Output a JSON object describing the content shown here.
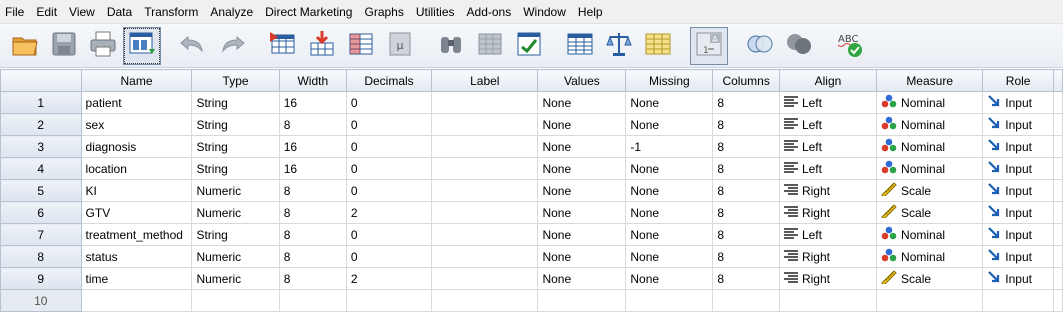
{
  "menu": [
    "File",
    "Edit",
    "View",
    "Data",
    "Transform",
    "Analyze",
    "Direct Marketing",
    "Graphs",
    "Utilities",
    "Add-ons",
    "Window",
    "Help"
  ],
  "toolbar": [
    {
      "name": "open-icon"
    },
    {
      "name": "save-icon"
    },
    {
      "name": "print-icon"
    },
    {
      "name": "dialog-recall-icon"
    },
    {
      "name": "undo-icon"
    },
    {
      "name": "redo-icon"
    },
    {
      "name": "goto-case-icon"
    },
    {
      "name": "goto-variable-icon"
    },
    {
      "name": "variables-icon"
    },
    {
      "name": "run-descriptives-icon"
    },
    {
      "name": "find-icon"
    },
    {
      "name": "insert-cases-icon"
    },
    {
      "name": "insert-variable-icon"
    },
    {
      "name": "split-file-icon"
    },
    {
      "name": "weight-cases-icon"
    },
    {
      "name": "select-cases-icon"
    },
    {
      "name": "value-labels-icon"
    },
    {
      "name": "use-variable-sets-icon"
    },
    {
      "name": "show-all-variables-icon"
    },
    {
      "name": "spell-check-icon"
    }
  ],
  "columns": [
    "Name",
    "Type",
    "Width",
    "Decimals",
    "Label",
    "Values",
    "Missing",
    "Columns",
    "Align",
    "Measure",
    "Role"
  ],
  "rows": [
    {
      "n": "1",
      "name": "patient",
      "type": "String",
      "width": "16",
      "decimals": "0",
      "label": "",
      "values": "None",
      "missing": "None",
      "columns": "8",
      "align": "Left",
      "measure": "Nominal",
      "role": "Input"
    },
    {
      "n": "2",
      "name": "sex",
      "type": "String",
      "width": "8",
      "decimals": "0",
      "label": "",
      "values": "None",
      "missing": "None",
      "columns": "8",
      "align": "Left",
      "measure": "Nominal",
      "role": "Input"
    },
    {
      "n": "3",
      "name": "diagnosis",
      "type": "String",
      "width": "16",
      "decimals": "0",
      "label": "",
      "values": "None",
      "missing": "-1",
      "columns": "8",
      "align": "Left",
      "measure": "Nominal",
      "role": "Input"
    },
    {
      "n": "4",
      "name": "location",
      "type": "String",
      "width": "16",
      "decimals": "0",
      "label": "",
      "values": "None",
      "missing": "None",
      "columns": "8",
      "align": "Left",
      "measure": "Nominal",
      "role": "Input"
    },
    {
      "n": "5",
      "name": "KI",
      "type": "Numeric",
      "width": "8",
      "decimals": "0",
      "label": "",
      "values": "None",
      "missing": "None",
      "columns": "8",
      "align": "Right",
      "measure": "Scale",
      "role": "Input"
    },
    {
      "n": "6",
      "name": "GTV",
      "type": "Numeric",
      "width": "8",
      "decimals": "2",
      "label": "",
      "values": "None",
      "missing": "None",
      "columns": "8",
      "align": "Right",
      "measure": "Scale",
      "role": "Input"
    },
    {
      "n": "7",
      "name": "treatment_method",
      "type": "String",
      "width": "8",
      "decimals": "0",
      "label": "",
      "values": "None",
      "missing": "None",
      "columns": "8",
      "align": "Left",
      "measure": "Nominal",
      "role": "Input"
    },
    {
      "n": "8",
      "name": "status",
      "type": "Numeric",
      "width": "8",
      "decimals": "0",
      "label": "",
      "values": "None",
      "missing": "None",
      "columns": "8",
      "align": "Right",
      "measure": "Nominal",
      "role": "Input"
    },
    {
      "n": "9",
      "name": "time",
      "type": "Numeric",
      "width": "8",
      "decimals": "2",
      "label": "",
      "values": "None",
      "missing": "None",
      "columns": "8",
      "align": "Right",
      "measure": "Scale",
      "role": "Input"
    }
  ],
  "empty_row": "10",
  "colors": {
    "accent": "#1a5fb4",
    "header_bg": "#e3e9f1",
    "grid_line": "#d9d9d9"
  }
}
